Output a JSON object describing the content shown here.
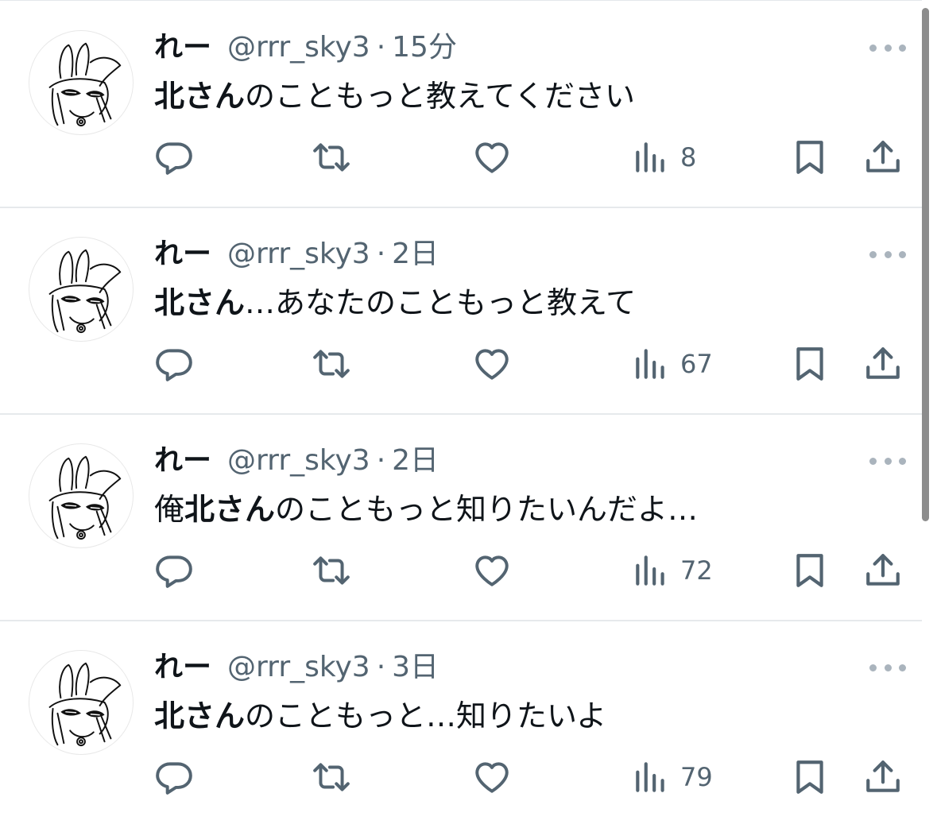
{
  "tweets": [
    {
      "display_name": "れー",
      "handle": "@rrr_sky3",
      "separator": "·",
      "time": "15分",
      "text_bold": "北さん",
      "text_prefix": "",
      "text_rest": "のこともっと教えてください",
      "views": "8"
    },
    {
      "display_name": "れー",
      "handle": "@rrr_sky3",
      "separator": "·",
      "time": "2日",
      "text_bold": "北さん",
      "text_prefix": "",
      "text_rest": "…あなたのこともっと教えて",
      "views": "67"
    },
    {
      "display_name": "れー",
      "handle": "@rrr_sky3",
      "separator": "·",
      "time": "2日",
      "text_bold": "北さん",
      "text_prefix": "俺",
      "text_rest": "のこともっと知りたいんだよ…",
      "views": "72"
    },
    {
      "display_name": "れー",
      "handle": "@rrr_sky3",
      "separator": "·",
      "time": "3日",
      "text_bold": "北さん",
      "text_prefix": "",
      "text_rest": "のこともっと…知りたいよ",
      "views": "79"
    }
  ],
  "icons": {
    "reply": "reply-icon",
    "retweet": "retweet-icon",
    "like": "like-icon",
    "views": "views-icon",
    "bookmark": "bookmark-icon",
    "share": "share-icon",
    "more": "more-icon"
  },
  "colors": {
    "text_primary": "#0f1419",
    "text_secondary": "#536471",
    "divider": "#e6e9ec"
  }
}
